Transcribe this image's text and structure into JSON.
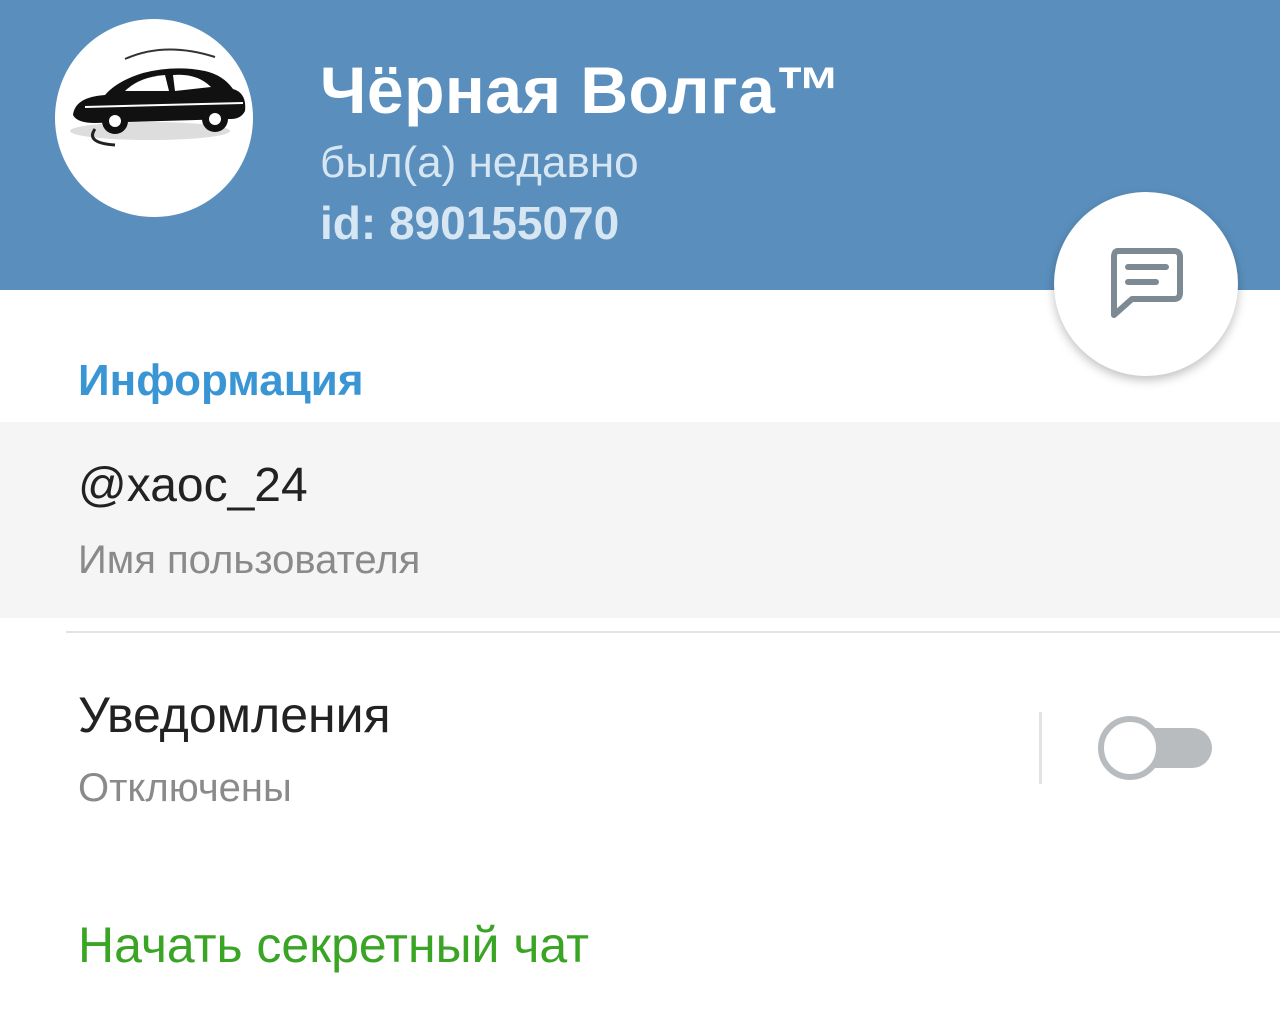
{
  "colors": {
    "header_bg": "#5a8fbd",
    "section_title": "#3a95d5",
    "secret_chat": "#3aa525",
    "toggle_off": "#b8bcbf"
  },
  "profile": {
    "avatar_icon": "car-logo-avatar",
    "name": "Чёрная Волга™",
    "status": "был(а) недавно",
    "id_text": "id: 890155070"
  },
  "fab": {
    "icon": "message-icon"
  },
  "info": {
    "section_title": "Информация",
    "username": "@хаос_24",
    "username_caption": "Имя пользователя"
  },
  "notifications": {
    "title": "Уведомления",
    "status": "Отключены",
    "enabled": false
  },
  "actions": {
    "secret_chat": "Начать секретный чат"
  }
}
